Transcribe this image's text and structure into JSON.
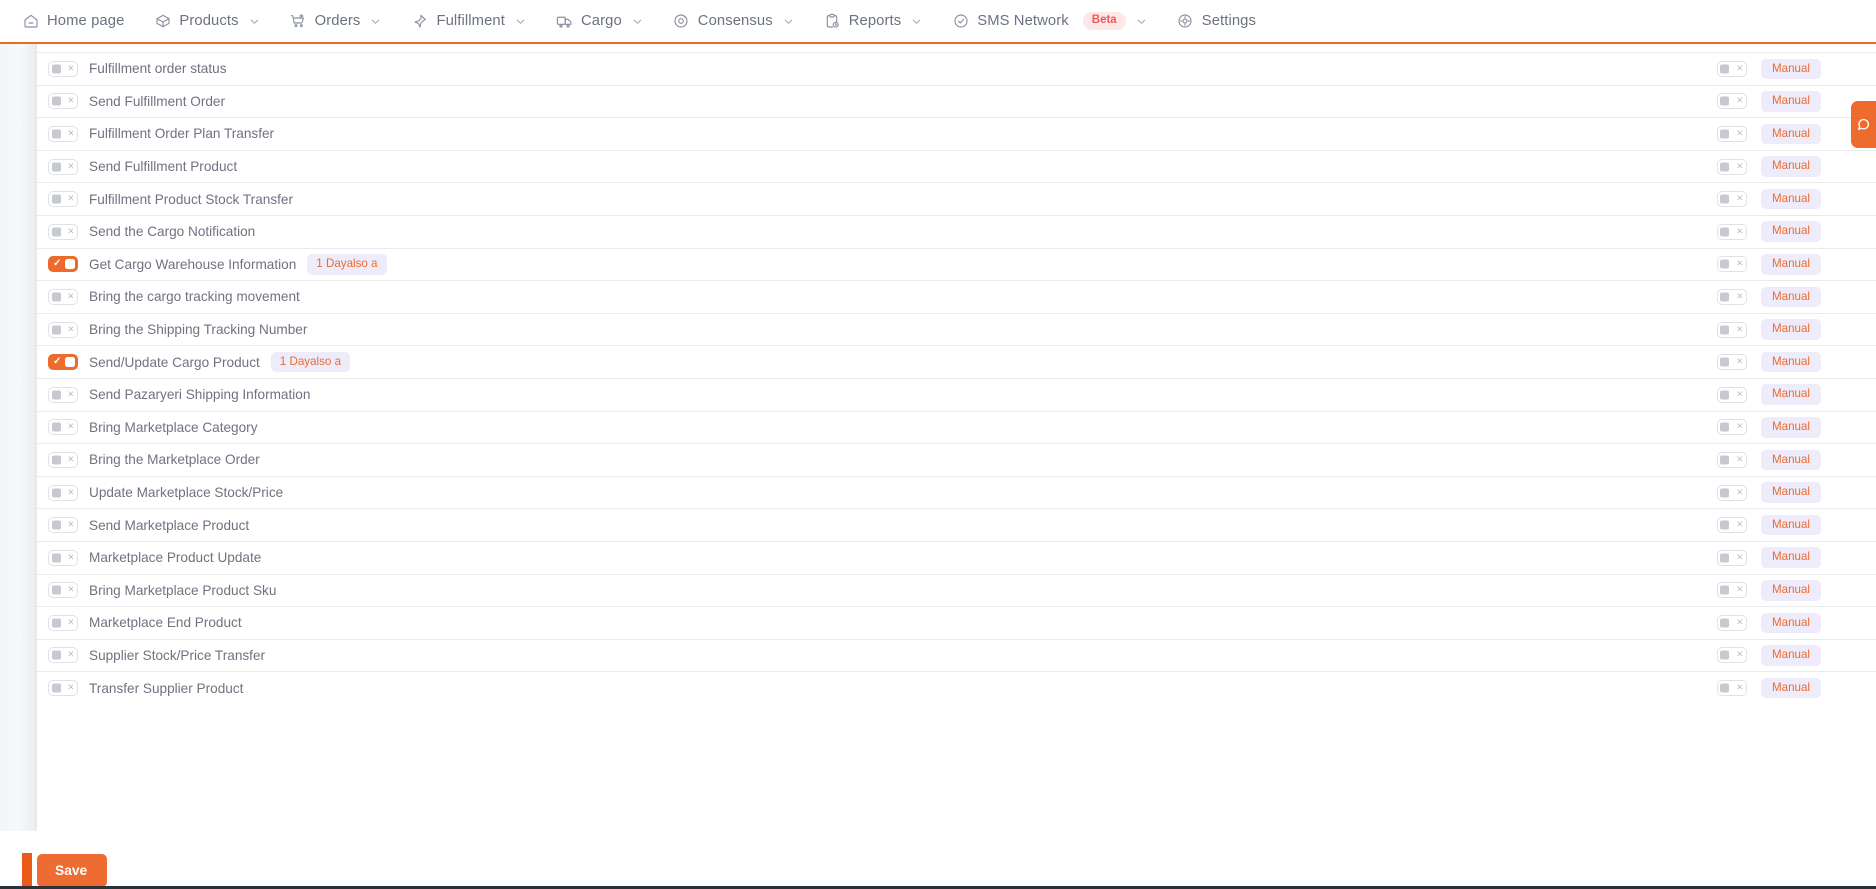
{
  "navbar": {
    "items": [
      {
        "label": "Home page",
        "icon": "home-icon",
        "caret": false,
        "badge": null
      },
      {
        "label": "Products",
        "icon": "box-icon",
        "caret": true,
        "badge": null
      },
      {
        "label": "Orders",
        "icon": "cart-plus-icon",
        "caret": true,
        "badge": null
      },
      {
        "label": "Fulfillment",
        "icon": "pin-icon",
        "caret": true,
        "badge": null
      },
      {
        "label": "Cargo",
        "icon": "truck-icon",
        "caret": true,
        "badge": null
      },
      {
        "label": "Consensus",
        "icon": "target-icon",
        "caret": true,
        "badge": null
      },
      {
        "label": "Reports",
        "icon": "clipboard-clock-icon",
        "caret": true,
        "badge": null
      },
      {
        "label": "SMS Network",
        "icon": "check-circle-icon",
        "caret": true,
        "badge": "Beta"
      },
      {
        "label": "Settings",
        "icon": "gear-circle-icon",
        "caret": false,
        "badge": null
      }
    ]
  },
  "colors": {
    "accent": "#ec6b2d",
    "accent_dark": "#ec5a19",
    "pill_bg": "#eeecfb",
    "pill_text": "#ec6b2d",
    "beta_bg": "#fde8e8",
    "beta_text": "#f2565b",
    "text": "#6f7380",
    "border": "#e9eaec"
  },
  "table": {
    "rows": [
      {
        "label": "Fulfillment order status",
        "enabled": false,
        "badge": null,
        "right_enabled": false,
        "right_badge": "Manual"
      },
      {
        "label": "Send Fulfillment Order",
        "enabled": false,
        "badge": null,
        "right_enabled": false,
        "right_badge": "Manual"
      },
      {
        "label": "Fulfillment Order Plan Transfer",
        "enabled": false,
        "badge": null,
        "right_enabled": false,
        "right_badge": "Manual"
      },
      {
        "label": "Send Fulfillment Product",
        "enabled": false,
        "badge": null,
        "right_enabled": false,
        "right_badge": "Manual"
      },
      {
        "label": "Fulfillment Product Stock Transfer",
        "enabled": false,
        "badge": null,
        "right_enabled": false,
        "right_badge": "Manual"
      },
      {
        "label": "Send the Cargo Notification",
        "enabled": false,
        "badge": null,
        "right_enabled": false,
        "right_badge": "Manual"
      },
      {
        "label": "Get Cargo Warehouse Information",
        "enabled": true,
        "badge": "1 Dayalso a",
        "right_enabled": false,
        "right_badge": "Manual"
      },
      {
        "label": "Bring the cargo tracking movement",
        "enabled": false,
        "badge": null,
        "right_enabled": false,
        "right_badge": "Manual"
      },
      {
        "label": "Bring the Shipping Tracking Number",
        "enabled": false,
        "badge": null,
        "right_enabled": false,
        "right_badge": "Manual"
      },
      {
        "label": "Send/Update Cargo Product",
        "enabled": true,
        "badge": "1 Dayalso a",
        "right_enabled": false,
        "right_badge": "Manual"
      },
      {
        "label": "Send Pazaryeri Shipping Information",
        "enabled": false,
        "badge": null,
        "right_enabled": false,
        "right_badge": "Manual"
      },
      {
        "label": "Bring Marketplace Category",
        "enabled": false,
        "badge": null,
        "right_enabled": false,
        "right_badge": "Manual"
      },
      {
        "label": "Bring the Marketplace Order",
        "enabled": false,
        "badge": null,
        "right_enabled": false,
        "right_badge": "Manual"
      },
      {
        "label": "Update Marketplace Stock/Price",
        "enabled": false,
        "badge": null,
        "right_enabled": false,
        "right_badge": "Manual"
      },
      {
        "label": "Send Marketplace Product",
        "enabled": false,
        "badge": null,
        "right_enabled": false,
        "right_badge": "Manual"
      },
      {
        "label": "Marketplace Product Update",
        "enabled": false,
        "badge": null,
        "right_enabled": false,
        "right_badge": "Manual"
      },
      {
        "label": "Bring Marketplace Product Sku",
        "enabled": false,
        "badge": null,
        "right_enabled": false,
        "right_badge": "Manual"
      },
      {
        "label": "Marketplace End Product",
        "enabled": false,
        "badge": null,
        "right_enabled": false,
        "right_badge": "Manual"
      },
      {
        "label": "Supplier Stock/Price Transfer",
        "enabled": false,
        "badge": null,
        "right_enabled": false,
        "right_badge": "Manual"
      },
      {
        "label": "Transfer Supplier Product",
        "enabled": false,
        "badge": null,
        "right_enabled": false,
        "right_badge": "Manual"
      }
    ]
  },
  "side_tab": {
    "icon": "support-chat-icon"
  },
  "footer": {
    "save_label": "Save"
  }
}
